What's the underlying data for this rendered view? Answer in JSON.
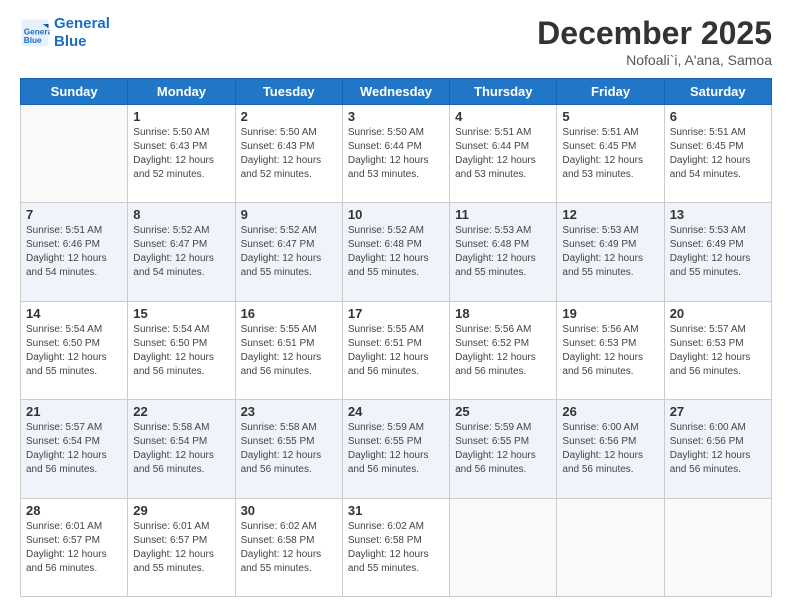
{
  "header": {
    "logo_line1": "General",
    "logo_line2": "Blue",
    "month": "December 2025",
    "location": "Nofoali`i, A'ana, Samoa"
  },
  "weekdays": [
    "Sunday",
    "Monday",
    "Tuesday",
    "Wednesday",
    "Thursday",
    "Friday",
    "Saturday"
  ],
  "weeks": [
    [
      {
        "day": "",
        "info": ""
      },
      {
        "day": "1",
        "info": "Sunrise: 5:50 AM\nSunset: 6:43 PM\nDaylight: 12 hours\nand 52 minutes."
      },
      {
        "day": "2",
        "info": "Sunrise: 5:50 AM\nSunset: 6:43 PM\nDaylight: 12 hours\nand 52 minutes."
      },
      {
        "day": "3",
        "info": "Sunrise: 5:50 AM\nSunset: 6:44 PM\nDaylight: 12 hours\nand 53 minutes."
      },
      {
        "day": "4",
        "info": "Sunrise: 5:51 AM\nSunset: 6:44 PM\nDaylight: 12 hours\nand 53 minutes."
      },
      {
        "day": "5",
        "info": "Sunrise: 5:51 AM\nSunset: 6:45 PM\nDaylight: 12 hours\nand 53 minutes."
      },
      {
        "day": "6",
        "info": "Sunrise: 5:51 AM\nSunset: 6:45 PM\nDaylight: 12 hours\nand 54 minutes."
      }
    ],
    [
      {
        "day": "7",
        "info": "Sunrise: 5:51 AM\nSunset: 6:46 PM\nDaylight: 12 hours\nand 54 minutes."
      },
      {
        "day": "8",
        "info": "Sunrise: 5:52 AM\nSunset: 6:47 PM\nDaylight: 12 hours\nand 54 minutes."
      },
      {
        "day": "9",
        "info": "Sunrise: 5:52 AM\nSunset: 6:47 PM\nDaylight: 12 hours\nand 55 minutes."
      },
      {
        "day": "10",
        "info": "Sunrise: 5:52 AM\nSunset: 6:48 PM\nDaylight: 12 hours\nand 55 minutes."
      },
      {
        "day": "11",
        "info": "Sunrise: 5:53 AM\nSunset: 6:48 PM\nDaylight: 12 hours\nand 55 minutes."
      },
      {
        "day": "12",
        "info": "Sunrise: 5:53 AM\nSunset: 6:49 PM\nDaylight: 12 hours\nand 55 minutes."
      },
      {
        "day": "13",
        "info": "Sunrise: 5:53 AM\nSunset: 6:49 PM\nDaylight: 12 hours\nand 55 minutes."
      }
    ],
    [
      {
        "day": "14",
        "info": "Sunrise: 5:54 AM\nSunset: 6:50 PM\nDaylight: 12 hours\nand 55 minutes."
      },
      {
        "day": "15",
        "info": "Sunrise: 5:54 AM\nSunset: 6:50 PM\nDaylight: 12 hours\nand 56 minutes."
      },
      {
        "day": "16",
        "info": "Sunrise: 5:55 AM\nSunset: 6:51 PM\nDaylight: 12 hours\nand 56 minutes."
      },
      {
        "day": "17",
        "info": "Sunrise: 5:55 AM\nSunset: 6:51 PM\nDaylight: 12 hours\nand 56 minutes."
      },
      {
        "day": "18",
        "info": "Sunrise: 5:56 AM\nSunset: 6:52 PM\nDaylight: 12 hours\nand 56 minutes."
      },
      {
        "day": "19",
        "info": "Sunrise: 5:56 AM\nSunset: 6:53 PM\nDaylight: 12 hours\nand 56 minutes."
      },
      {
        "day": "20",
        "info": "Sunrise: 5:57 AM\nSunset: 6:53 PM\nDaylight: 12 hours\nand 56 minutes."
      }
    ],
    [
      {
        "day": "21",
        "info": "Sunrise: 5:57 AM\nSunset: 6:54 PM\nDaylight: 12 hours\nand 56 minutes."
      },
      {
        "day": "22",
        "info": "Sunrise: 5:58 AM\nSunset: 6:54 PM\nDaylight: 12 hours\nand 56 minutes."
      },
      {
        "day": "23",
        "info": "Sunrise: 5:58 AM\nSunset: 6:55 PM\nDaylight: 12 hours\nand 56 minutes."
      },
      {
        "day": "24",
        "info": "Sunrise: 5:59 AM\nSunset: 6:55 PM\nDaylight: 12 hours\nand 56 minutes."
      },
      {
        "day": "25",
        "info": "Sunrise: 5:59 AM\nSunset: 6:55 PM\nDaylight: 12 hours\nand 56 minutes."
      },
      {
        "day": "26",
        "info": "Sunrise: 6:00 AM\nSunset: 6:56 PM\nDaylight: 12 hours\nand 56 minutes."
      },
      {
        "day": "27",
        "info": "Sunrise: 6:00 AM\nSunset: 6:56 PM\nDaylight: 12 hours\nand 56 minutes."
      }
    ],
    [
      {
        "day": "28",
        "info": "Sunrise: 6:01 AM\nSunset: 6:57 PM\nDaylight: 12 hours\nand 56 minutes."
      },
      {
        "day": "29",
        "info": "Sunrise: 6:01 AM\nSunset: 6:57 PM\nDaylight: 12 hours\nand 55 minutes."
      },
      {
        "day": "30",
        "info": "Sunrise: 6:02 AM\nSunset: 6:58 PM\nDaylight: 12 hours\nand 55 minutes."
      },
      {
        "day": "31",
        "info": "Sunrise: 6:02 AM\nSunset: 6:58 PM\nDaylight: 12 hours\nand 55 minutes."
      },
      {
        "day": "",
        "info": ""
      },
      {
        "day": "",
        "info": ""
      },
      {
        "day": "",
        "info": ""
      }
    ]
  ]
}
